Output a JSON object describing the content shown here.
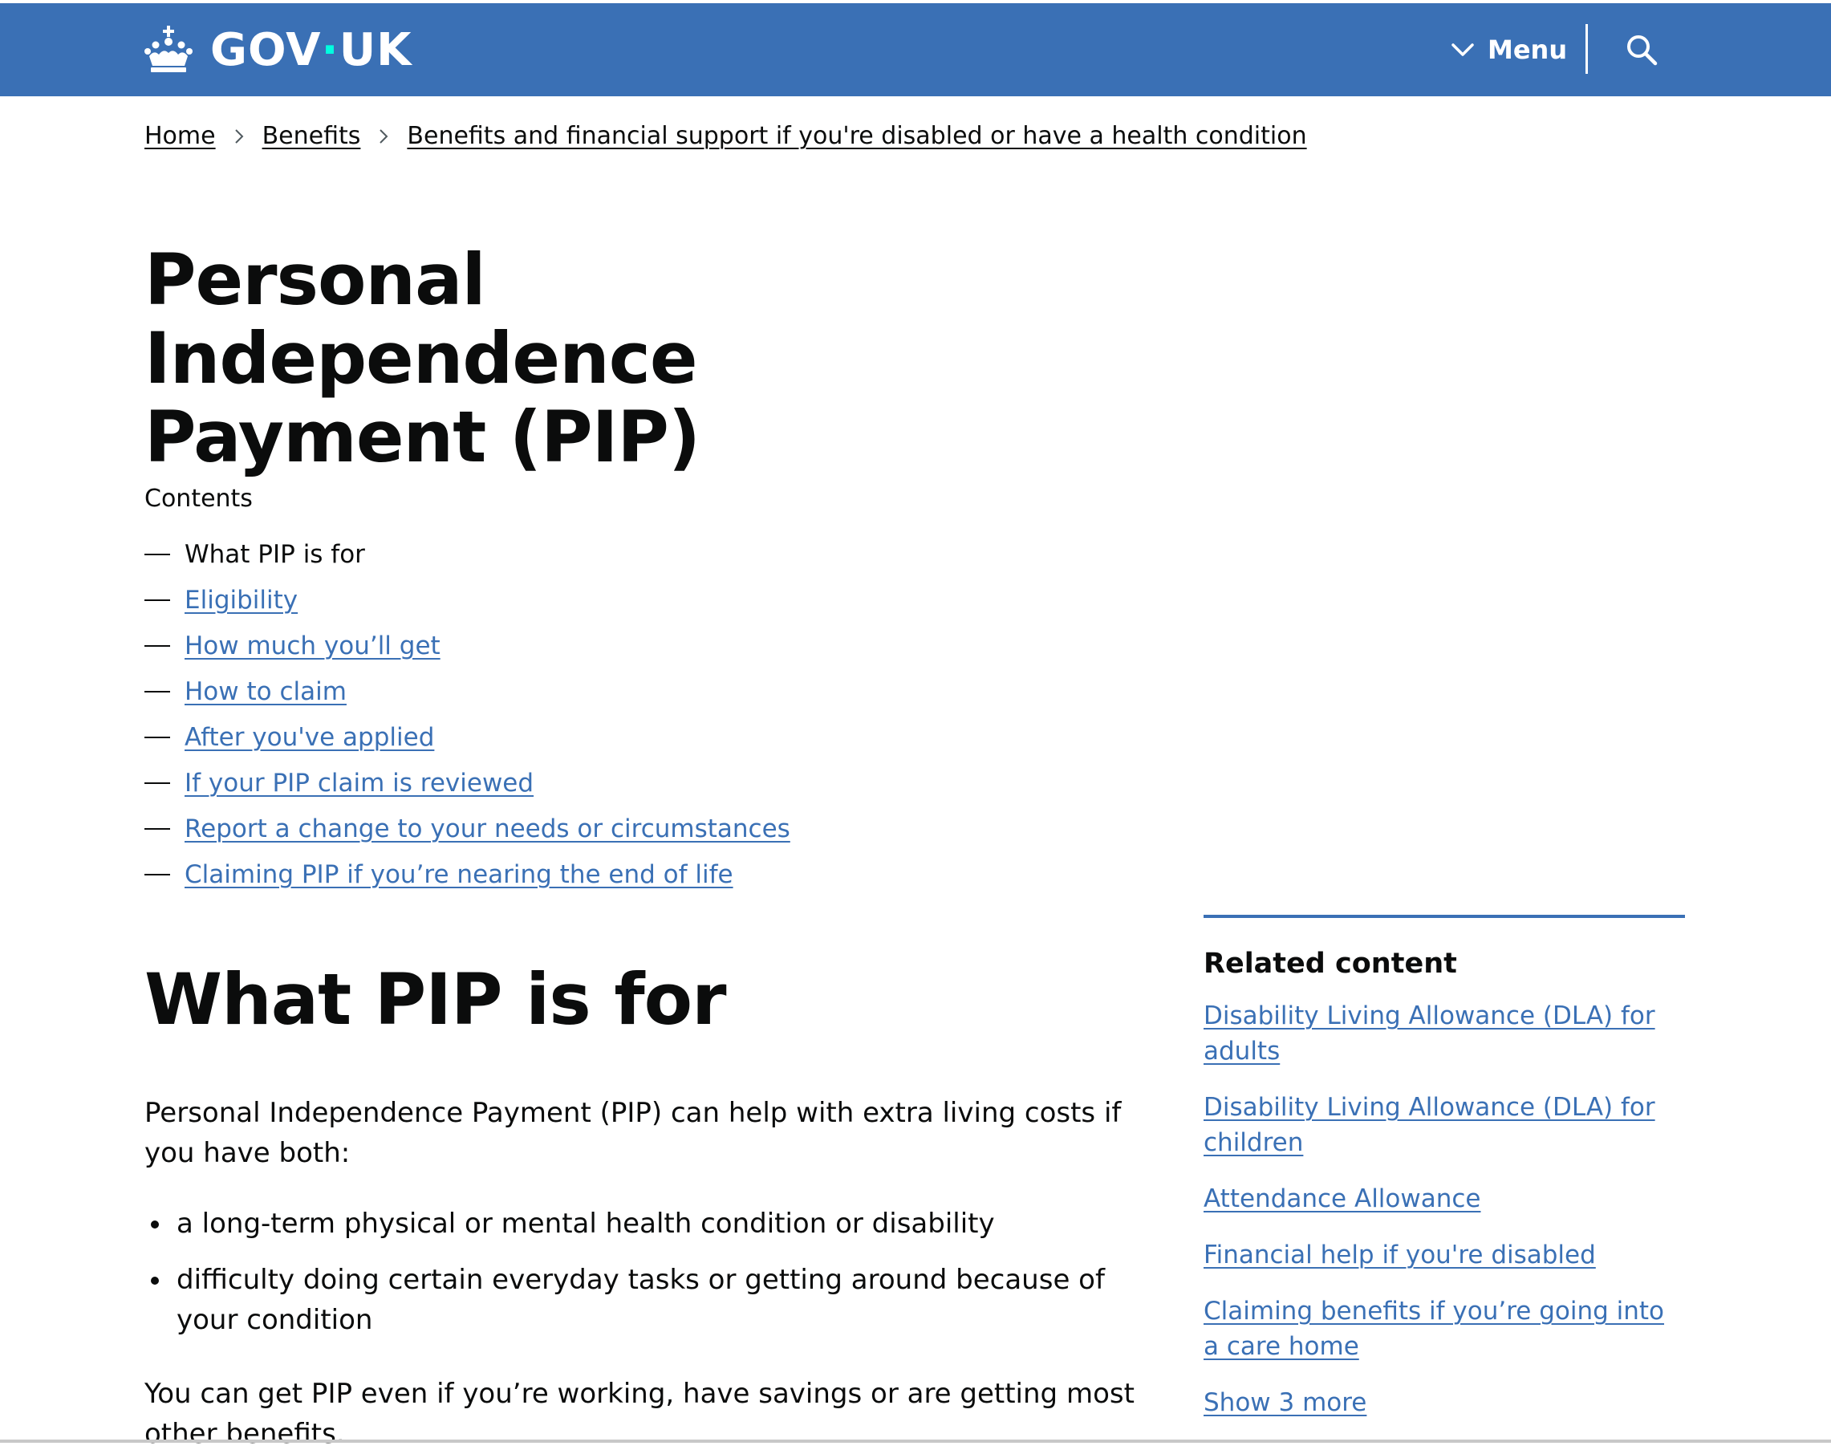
{
  "header": {
    "logo_text_left": "GOV",
    "logo_text_dot": "·",
    "logo_text_right": "UK",
    "menu_label": "Menu",
    "brand_color": "#3a70b5",
    "icons": [
      "crown-icon",
      "chevron-down-icon",
      "search-icon"
    ]
  },
  "breadcrumb": {
    "items": [
      {
        "label": "Home"
      },
      {
        "label": "Benefits"
      },
      {
        "label": "Benefits and financial support if you're disabled or have a health condition"
      }
    ]
  },
  "page": {
    "title": "Personal Independence Payment (PIP)"
  },
  "contents": {
    "label": "Contents",
    "items": [
      {
        "label": "What PIP is for",
        "current": true
      },
      {
        "label": "Eligibility"
      },
      {
        "label": "How much you’ll get"
      },
      {
        "label": "How to claim"
      },
      {
        "label": "After you've applied"
      },
      {
        "label": "If your PIP claim is reviewed"
      },
      {
        "label": "Report a change to your needs or circumstances"
      },
      {
        "label": "Claiming PIP if you’re nearing the end of life"
      }
    ]
  },
  "section": {
    "title": "What PIP is for",
    "intro": "Personal Independence Payment (PIP) can help with extra living costs if you have both:",
    "bullets": [
      "a long-term physical or mental health condition or disability",
      "difficulty doing certain everyday tasks or getting around because of your condition"
    ],
    "para2": "You can get PIP even if you’re working, have savings or are getting most other benefits."
  },
  "related": {
    "heading": "Related content",
    "links": [
      "Disability Living Allowance (DLA) for adults",
      "Disability Living Allowance (DLA) for children",
      "Attendance Allowance",
      "Financial help if you're disabled",
      "Claiming benefits if you’re going into a care home"
    ],
    "show_more": "Show 3 more"
  }
}
